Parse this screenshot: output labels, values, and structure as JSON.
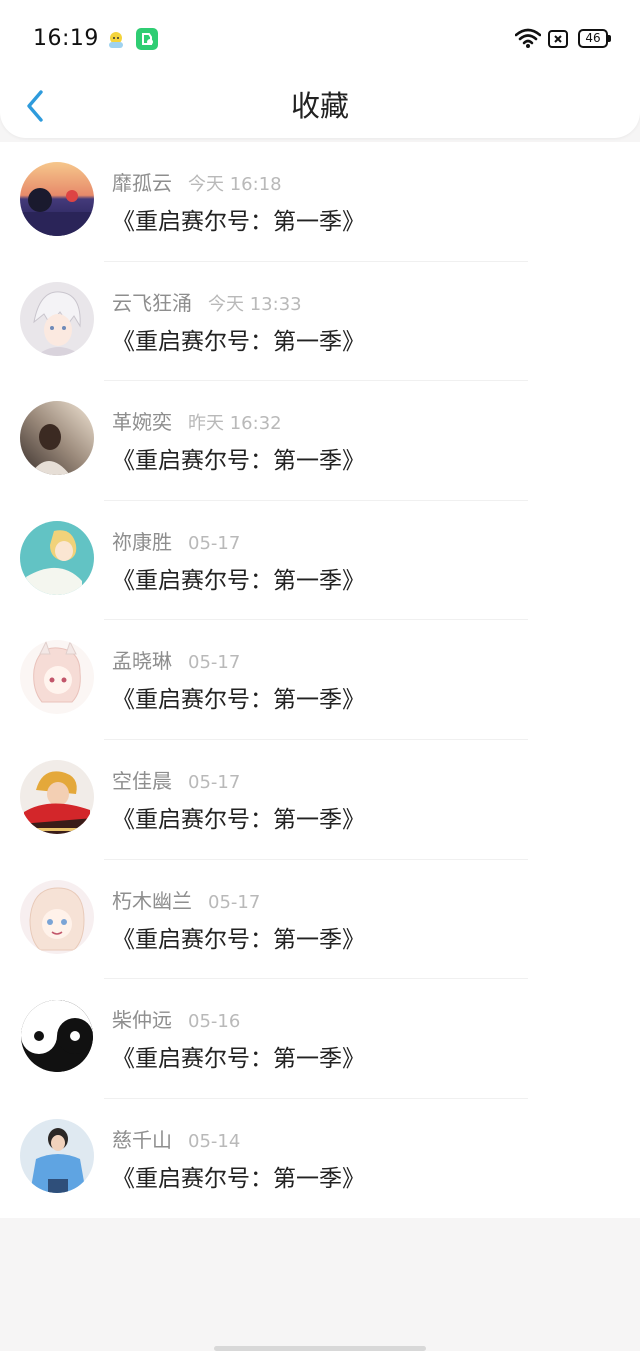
{
  "status_bar": {
    "time": "16:19",
    "battery_level": "46"
  },
  "header": {
    "title": "收藏",
    "back_icon": "chevron-left-icon",
    "accent_color": "#2e9bdc"
  },
  "favorites": [
    {
      "name": "靡孤云",
      "time": "今天 16:18",
      "content": "《重启赛尔号：第一季》",
      "avatar": "avatar-dusk-car"
    },
    {
      "name": "云飞狂涌",
      "time": "今天 13:33",
      "content": "《重启赛尔号：第一季》",
      "avatar": "avatar-anime-white-hair"
    },
    {
      "name": "革婉奕",
      "time": "昨天 16:32",
      "content": "《重启赛尔号：第一季》",
      "avatar": "avatar-girl-window"
    },
    {
      "name": "祢康胜",
      "time": "05-17",
      "content": "《重启赛尔号：第一季》",
      "avatar": "avatar-anime-blonde"
    },
    {
      "name": "孟晓琳",
      "time": "05-17",
      "content": "《重启赛尔号：第一季》",
      "avatar": "avatar-anime-bunny"
    },
    {
      "name": "空佳晨",
      "time": "05-17",
      "content": "《重启赛尔号：第一季》",
      "avatar": "avatar-girl-red-scarf"
    },
    {
      "name": "朽木幽兰",
      "time": "05-17",
      "content": "《重启赛尔号：第一季》",
      "avatar": "avatar-anime-pink-hair"
    },
    {
      "name": "柴仲远",
      "time": "05-16",
      "content": "《重启赛尔号：第一季》",
      "avatar": "avatar-yin-yang"
    },
    {
      "name": "慈千山",
      "time": "05-14",
      "content": "《重启赛尔号：第一季》",
      "avatar": "avatar-girl-blue-shirt"
    }
  ]
}
